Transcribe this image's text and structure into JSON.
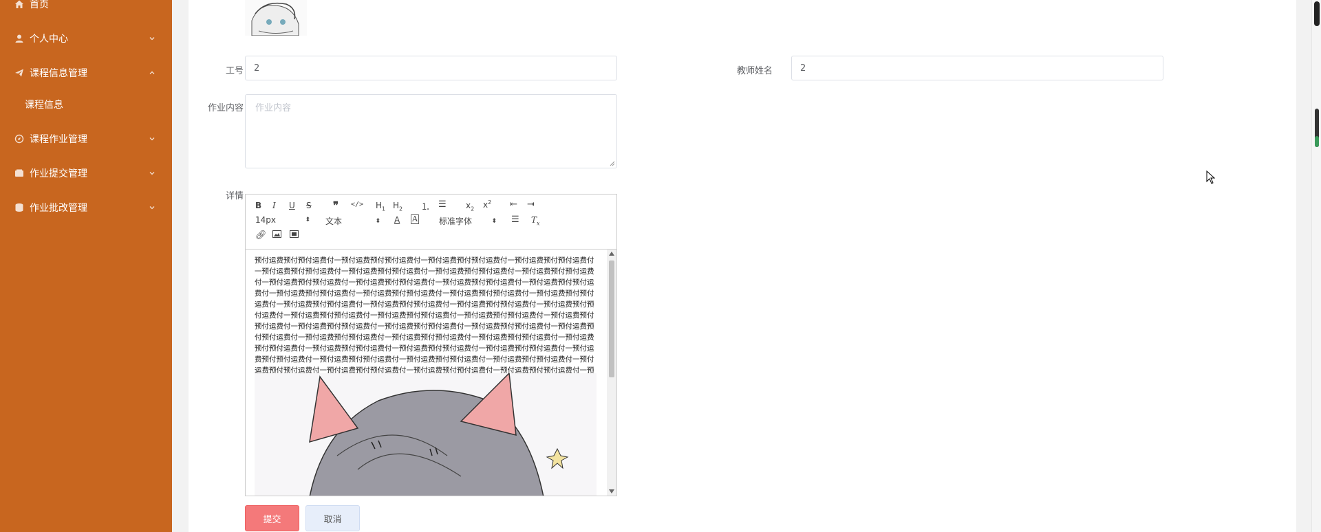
{
  "sidebar": {
    "items": [
      {
        "label": "首页"
      },
      {
        "label": "个人中心"
      },
      {
        "label": "课程信息管理"
      },
      {
        "label": "课程作业管理"
      },
      {
        "label": "作业提交管理"
      },
      {
        "label": "作业批改管理"
      }
    ],
    "subitems": [
      {
        "label": "课程信息"
      }
    ]
  },
  "form": {
    "teacher_id_label": "工号",
    "teacher_id_value": "2",
    "teacher_name_label": "教师姓名",
    "teacher_name_value": "2",
    "homework_label": "作业内容",
    "homework_placeholder": "作业内容",
    "detail_label": "详情"
  },
  "editor": {
    "font_size": "14px",
    "block_type": "文本",
    "font_family": "标准字体",
    "content_text": "预付运费预付预付运费付一预付运费预付预付运费付一预付运费预付预付运费付一预付运费预付预付运费付一预付运费预付预付运费付一预付运费预付预付运费付一预付运费预付预付运费付一预付运费预付预付运费付一预付运费预付预付运费付一预付运费预付预付运费付一预付运费预付预付运费付一预付运费预付预付运费付一预付运费预付预付运费付一预付运费预付预付运费付一预付运费预付预付运费付一预付运费预付预付运费付一预付运费预付预付运费付一预付运费预付预付运费付一预付运费预付预付运费付一预付运费预付预付运费付一预付运费预付预付运费付一预付运费预付预付运费付一预付运费预付预付运费付一预付运费预付预付运费付一预付运费预付预付运费付一预付运费预付预付运费付一预付运费预付预付运费付一预付运费预付预付运费付一预付运费预付预付运费付一预付运费预付预付运费付一预付运费预付预付运费付一预付运费预付预付运费付一预付运费预付预付运费付一预付运费预付预付运费付一预付运费预付预付运费付一预付运费预付预付运费付一预付运费预付预付运费付一预付运费预付预付运费付一预付运费预付预付运费付一预付运费预付预付运费付一预付运费预付预付运费付一预付运费预付预付运费付一预付运费预付预付运费付一预付运费预付预付运费付一预付运费预付预付运费付一预付运费预付预付运费付一预付运费预付预付运费付一预付运费预付预付运费付一预付运费预付预付运费付一预付运费预付预付运费付一预付运费预付预付运费付一预付运费预付预付运费付一预付运费预付预付运费付一预付运费预付预付运费付一"
  },
  "buttons": {
    "submit": "提交",
    "cancel": "取消"
  },
  "colors": {
    "sidebar": "#c8661f",
    "submit": "#f4797a",
    "cancel": "#e7eefa"
  }
}
